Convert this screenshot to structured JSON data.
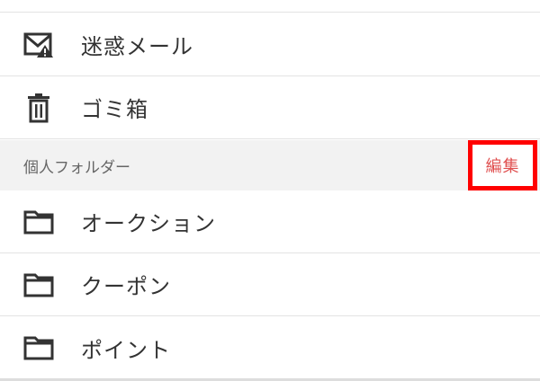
{
  "menu": {
    "items": [
      {
        "label": "迷惑メール",
        "icon": "spam-mail-icon"
      },
      {
        "label": "ゴミ箱",
        "icon": "trash-icon"
      }
    ]
  },
  "folders_section": {
    "title": "個人フォルダー",
    "edit_label": "編集",
    "items": [
      {
        "label": "オークション",
        "icon": "folder-icon"
      },
      {
        "label": "クーポン",
        "icon": "folder-icon"
      },
      {
        "label": "ポイント",
        "icon": "folder-icon"
      }
    ]
  },
  "colors": {
    "text": "#333333",
    "section_bg": "#f2f2f2",
    "edit_text": "#e05050",
    "highlight_border": "#ff0000"
  }
}
